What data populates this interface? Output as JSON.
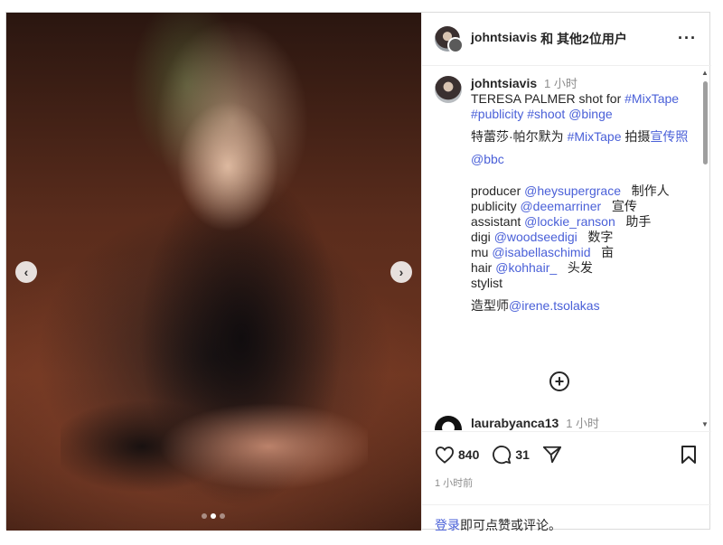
{
  "post": {
    "header": {
      "username": "johntsiavis",
      "others": "和 其他2位用户"
    },
    "caption": {
      "username": "johntsiavis",
      "time": "1 小时",
      "line1_text": "TERESA PALMER shot for ",
      "line1_tag1": "#MixTape",
      "line1_tag2": "#publicity",
      "line1_tag3": "#shoot",
      "line1_tag4": "@binge",
      "line2_text": "特蕾莎·帕尔默为 ",
      "line2_tag": "#MixTape",
      "line2_text2": " 拍摄",
      "line2_link": "宣传照",
      "bbc": "@bbc",
      "credits": [
        {
          "role": "producer ",
          "handle": "@heysupergrace",
          "cn": "   制作人"
        },
        {
          "role": "publicity ",
          "handle": "@deemarriner",
          "cn": "   宣传"
        },
        {
          "role": "assistant ",
          "handle": "@lockie_ranson",
          "cn": "   助手"
        },
        {
          "role": "digi ",
          "handle": "@woodseedigi",
          "cn": "   数字"
        },
        {
          "role": "mu ",
          "handle": "@isabellaschimid",
          "cn": "   亩"
        },
        {
          "role": "hair ",
          "handle": "@kohhair_",
          "cn": "   头发"
        }
      ],
      "stylist": "stylist",
      "stylist_cn": "造型师",
      "stylist_handle": "@irene.tsolakas"
    },
    "comment": {
      "username": "laurabyanca13",
      "time": "1 小时",
      "text": "🤩🤩🤩🤩"
    },
    "likes": "840",
    "comments_count": "31",
    "posted_ago": "1 小时前",
    "login_link": "登录",
    "login_text": "即可点赞或评论。",
    "carousel": {
      "count": 3,
      "active": 1
    }
  }
}
